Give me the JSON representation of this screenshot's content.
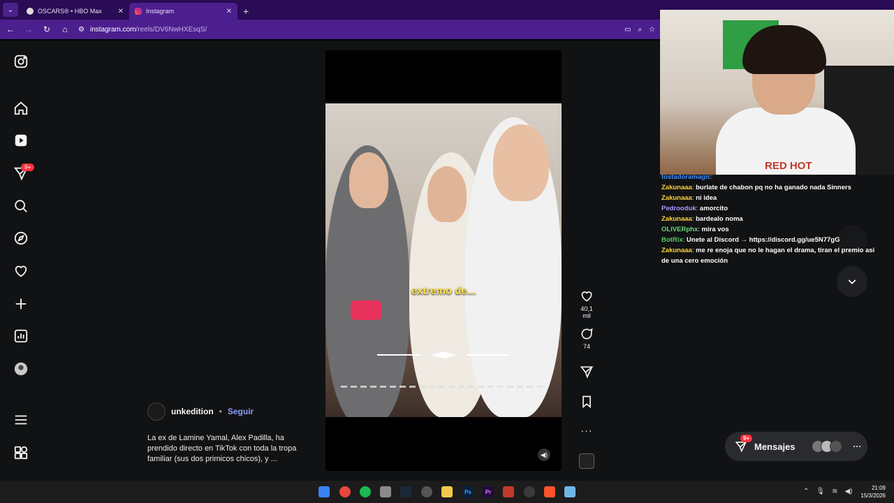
{
  "browser": {
    "tabs": [
      {
        "title": "OSCARS® • HBO Max",
        "active": false
      },
      {
        "title": "Instagram",
        "active": true
      }
    ],
    "new_tab": "+",
    "url_host": "instagram.com",
    "url_path": "/reels/DV6NwHXEsqS/"
  },
  "sidebar": {
    "notifications_badge": "9+",
    "items": [
      "instagram-logo",
      "home",
      "reels",
      "messages",
      "search",
      "explore",
      "notifications",
      "create",
      "dashboard",
      "profile",
      "more",
      "meta"
    ]
  },
  "reel": {
    "overlay_caption": "extremo de...",
    "likes": "40,1 mil",
    "comments": "74",
    "author": "unkedition",
    "separator": "•",
    "follow_label": "Seguir",
    "description": "La ex de Lamine Yamal, Alex Padilla, ha prendido directo en TikTok con toda la tropa familiar (sus dos primicos chicos), y ..."
  },
  "chat": {
    "messages": [
      {
        "user": "tostadoramagic",
        "text": "",
        "color": "#3d8bff"
      },
      {
        "user": "Zakunaaa",
        "text": "burlate de chabon pq no ha ganado nada Sinners",
        "color": "#ffd43b"
      },
      {
        "user": "Zakunaaa",
        "text": "ni idea",
        "color": "#ffd43b"
      },
      {
        "user": "Pedrooduk",
        "text": "amorcito",
        "color": "#b197fc"
      },
      {
        "user": "Zakunaaa",
        "text": "bardealo noma",
        "color": "#ffd43b"
      },
      {
        "user": "OLIVERphx",
        "text": "mira vos",
        "color": "#69db7c"
      },
      {
        "user": "BotRix",
        "text": "Unete al Discord → https://discord.gg/ue5N77gG",
        "color": "#51cf66"
      },
      {
        "user": "Zakunaaa",
        "text": "me re enoja que no le hagan el drama, tiran el premio asi",
        "color": "#ffd43b"
      },
      {
        "user": "",
        "text": "de una cero emoción",
        "color": "#ffffff"
      }
    ]
  },
  "stream_cam": {
    "shirt_text": "RED HOT"
  },
  "messages_button": {
    "label": "Mensajes",
    "badge": "9+",
    "more": "···"
  },
  "taskbar": {
    "apps": [
      {
        "name": "windows-start-icon",
        "label": "",
        "color": "#3b82f6"
      },
      {
        "name": "chrome-icon",
        "label": "",
        "color": "#e8453c"
      },
      {
        "name": "spotify-icon",
        "label": "",
        "color": "#1db954"
      },
      {
        "name": "discord-icon",
        "label": "",
        "color": "#8a8a8a"
      },
      {
        "name": "steam-icon",
        "label": "",
        "color": "#1b2838"
      },
      {
        "name": "obs-icon",
        "label": "",
        "color": "#555555"
      },
      {
        "name": "folder-icon",
        "label": "",
        "color": "#f2c94c"
      },
      {
        "name": "photoshop-icon",
        "label": "Ps",
        "color": "#0b1f3a"
      },
      {
        "name": "premiere-icon",
        "label": "Pr",
        "color": "#1f0b3a"
      },
      {
        "name": "app-red-icon",
        "label": "",
        "color": "#c0392b"
      },
      {
        "name": "cursor-app-icon",
        "label": "",
        "color": "#3a3a3a"
      },
      {
        "name": "brave-icon",
        "label": "",
        "color": "#fb542b"
      },
      {
        "name": "notepad-icon",
        "label": "",
        "color": "#6fb5e8"
      }
    ],
    "time": "21:09",
    "date": "15/3/2026"
  }
}
